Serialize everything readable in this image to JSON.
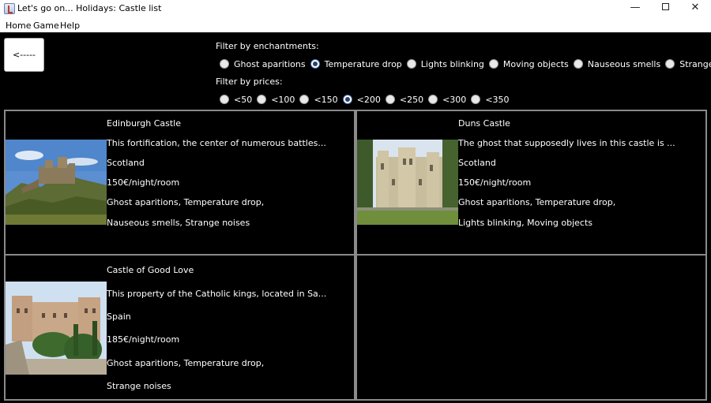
{
  "window": {
    "title": "Let's go on... Holidays: Castle list",
    "minimize_glyph": "—",
    "close_glyph": "✕"
  },
  "menu": [
    "Home",
    "Game",
    "Help"
  ],
  "back_button": {
    "label": "<-----"
  },
  "filters": {
    "enchantments": {
      "label": "Filter by enchantments:",
      "options": [
        "Ghost aparitions",
        "Temperature drop",
        "Lights blinking",
        "Moving objects",
        "Nauseous smells",
        "Strange noises"
      ],
      "selected": "Temperature drop"
    },
    "prices": {
      "label": "Filter by prices:",
      "options": [
        "<50",
        "<100",
        "<150",
        "<200",
        "<250",
        "<300",
        "<350"
      ],
      "selected": "<200"
    }
  },
  "castles": [
    {
      "name": "Edinburgh Castle",
      "description": "This fortification, the center of numerous battles...",
      "country": "Scotland",
      "price": "150€/night/room",
      "enchantments_line1": "Ghost aparitions, Temperature drop,",
      "enchantments_line2": "Nauseous smells, Strange noises"
    },
    {
      "name": "Duns Castle",
      "description": "The ghost that supposedly lives in this castle is ...",
      "country": "Scotland",
      "price": "150€/night/room",
      "enchantments_line1": "Ghost aparitions, Temperature drop,",
      "enchantments_line2": "Lights blinking, Moving objects"
    },
    {
      "name": "Castle of Good Love",
      "description": "This property of the Catholic kings, located in Sa...",
      "country": "Spain",
      "price": "185€/night/room",
      "enchantments_line1": "Ghost aparitions, Temperature drop,",
      "enchantments_line2": "Strange noises"
    }
  ]
}
